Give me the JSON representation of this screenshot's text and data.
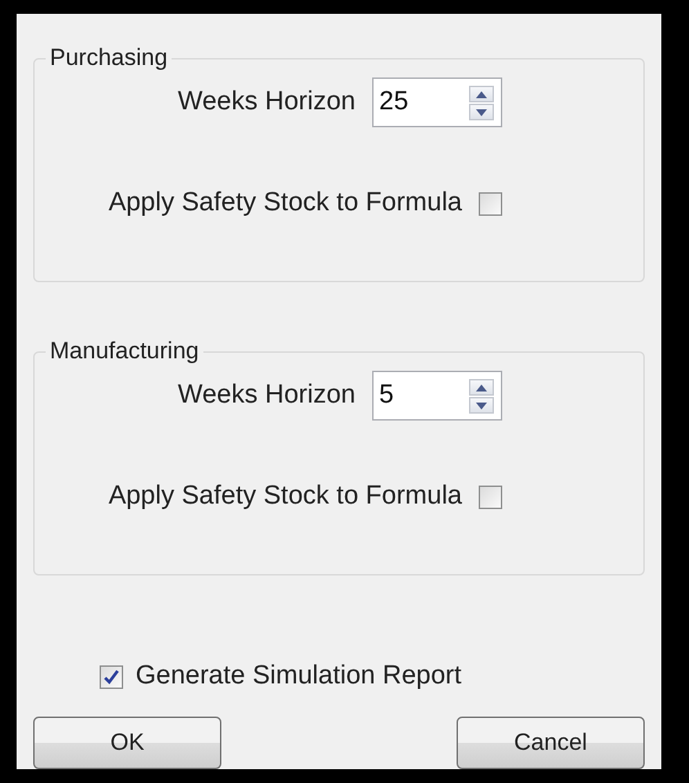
{
  "groups": [
    {
      "title": "Purchasing",
      "weeks_label": "Weeks Horizon",
      "weeks_value": "25",
      "safety_label": "Apply Safety Stock to Formula",
      "safety_checked": false
    },
    {
      "title": "Manufacturing",
      "weeks_label": "Weeks Horizon",
      "weeks_value": "5",
      "safety_label": "Apply Safety Stock to Formula",
      "safety_checked": false
    }
  ],
  "report": {
    "label": "Generate Simulation Report",
    "checked": true
  },
  "buttons": [
    "OK",
    "Cancel"
  ]
}
